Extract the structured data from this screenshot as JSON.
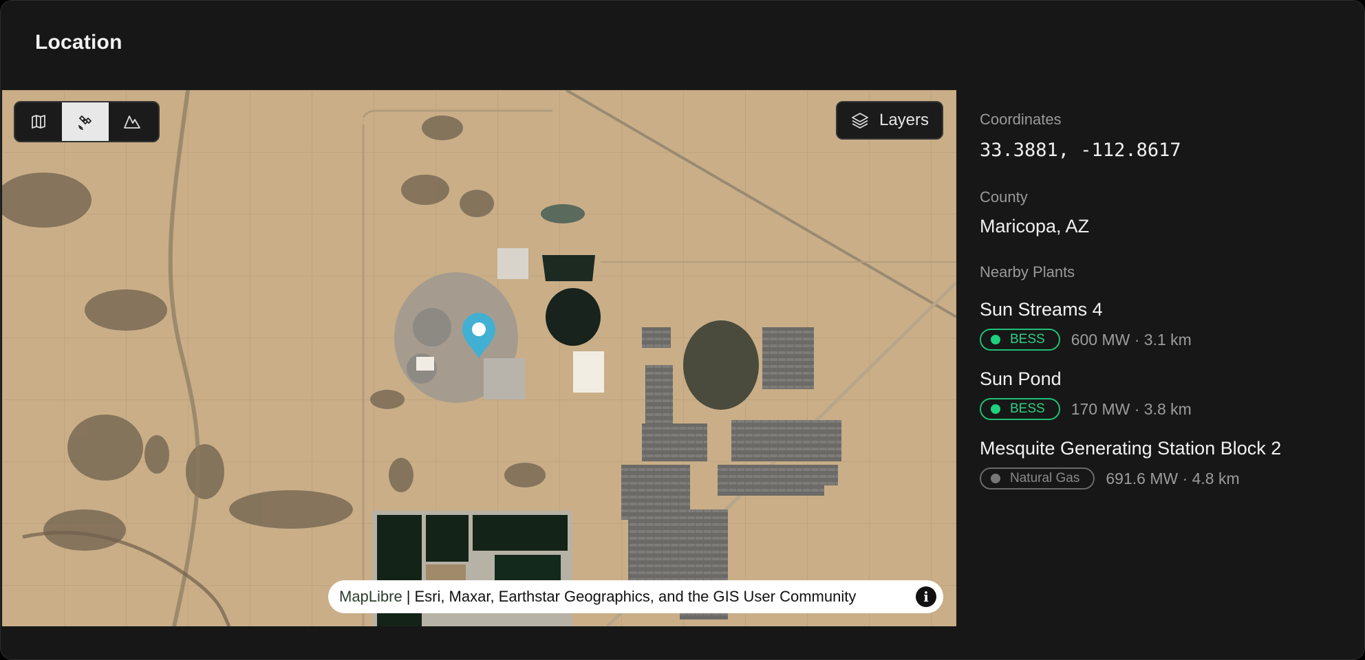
{
  "header": {
    "title": "Location"
  },
  "map": {
    "mode_buttons": [
      {
        "name": "map-view-icon",
        "active": false
      },
      {
        "name": "satellite-view-icon",
        "active": true
      },
      {
        "name": "terrain-view-icon",
        "active": false
      }
    ],
    "layers_label": "Layers",
    "attribution": {
      "library": "MapLibre",
      "separator": "|",
      "sources": "Esri, Maxar, Earthstar Geographics, and the GIS User Community"
    },
    "marker_color": "#41b0d2"
  },
  "details": {
    "coordinates_label": "Coordinates",
    "coordinates_value": "33.3881, -112.8617",
    "county_label": "County",
    "county_value": "Maricopa, AZ",
    "nearby_label": "Nearby Plants",
    "plants": [
      {
        "name": "Sun Streams 4",
        "type": "BESS",
        "meta": "600 MW · 3.1 km",
        "color": "#1fd07f"
      },
      {
        "name": "Sun Pond",
        "type": "BESS",
        "meta": "170 MW · 3.8 km",
        "color": "#1fd07f"
      },
      {
        "name": "Mesquite Generating Station Block 2",
        "type": "Natural Gas",
        "meta": "691.6 MW · 4.8 km",
        "color": "#777777"
      }
    ]
  }
}
